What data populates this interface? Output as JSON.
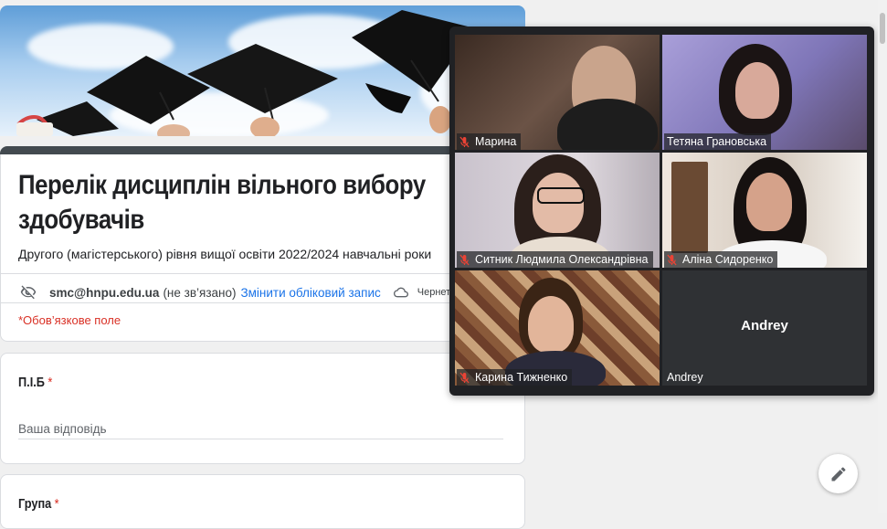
{
  "form": {
    "title": "Перелік дисциплін вільного вибору здобувачів",
    "subtitle": "Другого (магістерського) рівня вищої освіти 2022/2024 навчальні роки",
    "account_email": "smc@hnpu.edu.ua",
    "account_status": "(не зв’язано)",
    "switch_account_label": "Змінити обліковий запис",
    "draft_label": "Чернетку",
    "required_note": "*Обов’язкове поле",
    "questions": [
      {
        "label": "П.І.Б",
        "required_mark": "*",
        "placeholder": "Ваша відповідь"
      },
      {
        "label": "Група",
        "required_mark": "*"
      }
    ]
  },
  "meet": {
    "participants": [
      {
        "name": "Марина",
        "muted": true
      },
      {
        "name": "Тетяна Грановська",
        "muted": false
      },
      {
        "name": "Ситник Людмила Олександрівна",
        "muted": true
      },
      {
        "name": "Аліна Сидоренко",
        "muted": true
      },
      {
        "name": "Карина Тижненко",
        "muted": true
      },
      {
        "name": "Andrey",
        "muted": false,
        "camera_off": true,
        "center_label": "Andrey"
      }
    ]
  },
  "icons": {
    "visibility": "eye-off-icon",
    "cloud": "cloud-icon",
    "mic_off": "mic-off-icon",
    "edit": "pencil-icon"
  },
  "colors": {
    "accent_header": "#434a4f",
    "link": "#1a73e8",
    "required": "#d93025",
    "meet_bg": "#202124",
    "mic_off": "#ea4335"
  }
}
